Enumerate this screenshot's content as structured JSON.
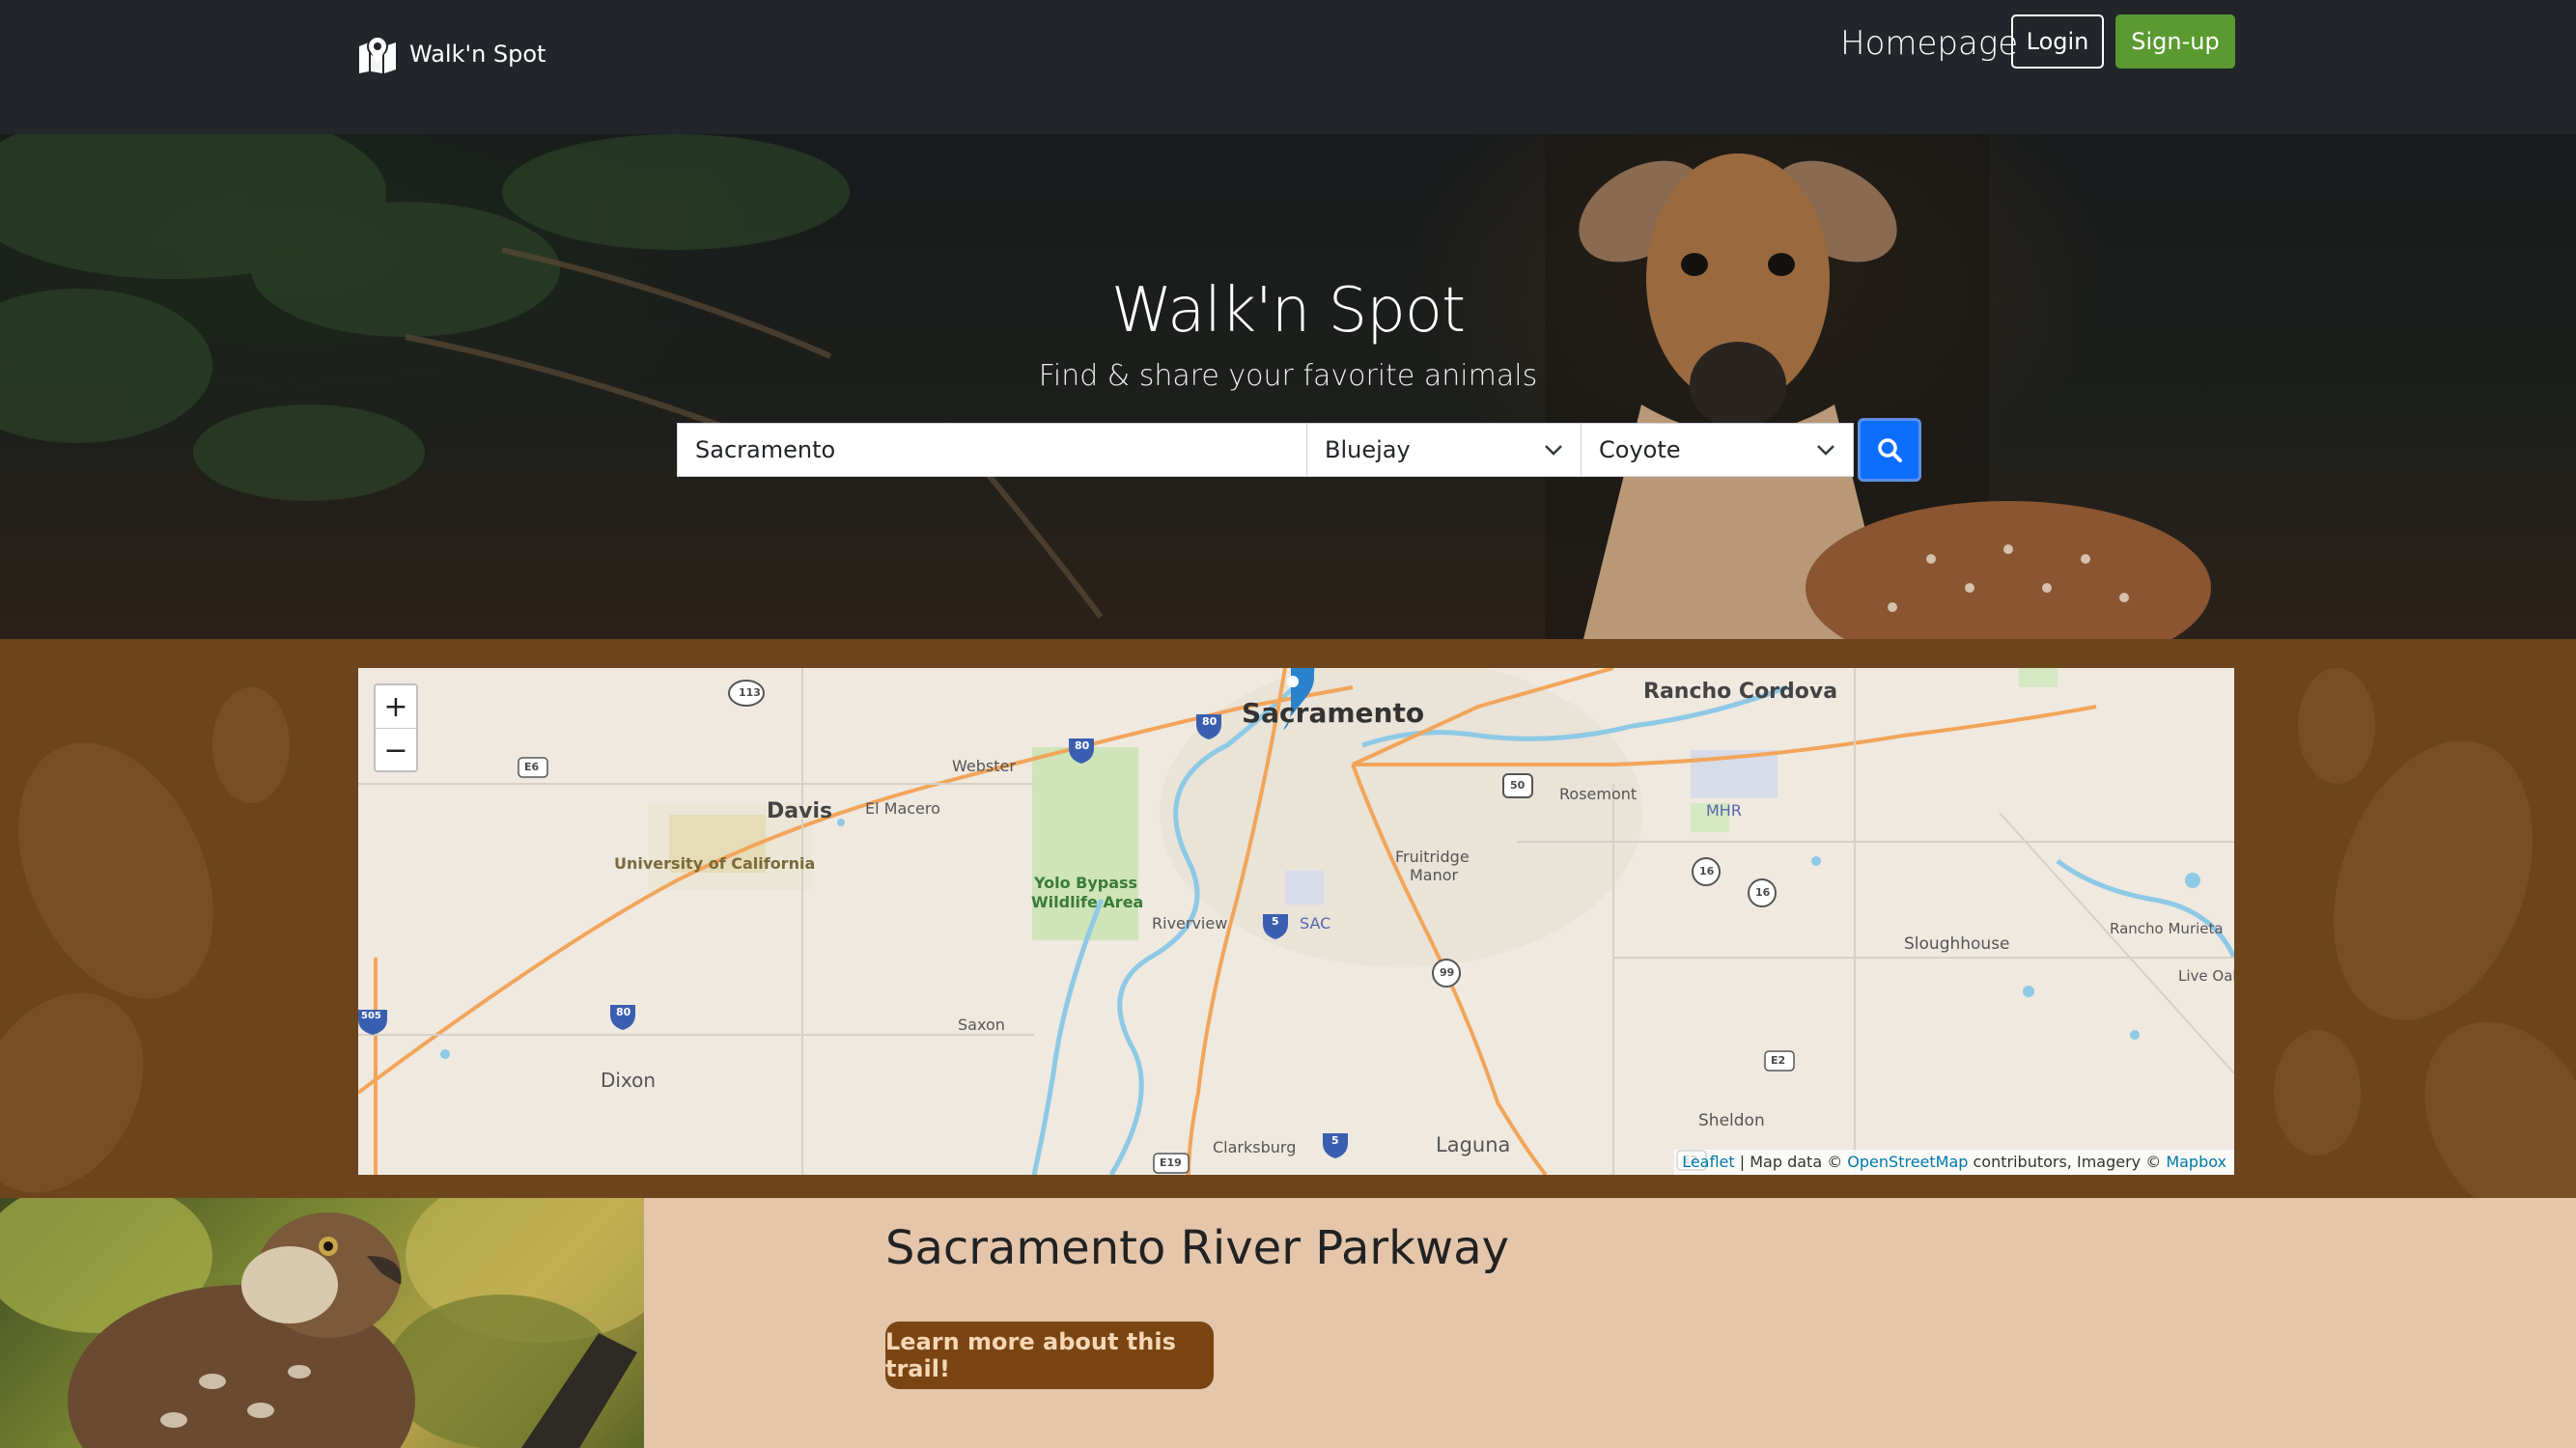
{
  "nav": {
    "brand": "Walk'n Spot",
    "homepage": "Homepage",
    "login": "Login",
    "signup": "Sign-up",
    "signup_color": "#5a9a30"
  },
  "hero": {
    "title": "Walk'n Spot",
    "subtitle": "Find & share your favorite animals",
    "search": {
      "location_value": "Sacramento",
      "animal_1_selected": "Bluejay",
      "animal_2_selected": "Coyote",
      "search_icon": "search-icon",
      "button_color": "#0d6efd"
    }
  },
  "map": {
    "zoom_in": "+",
    "zoom_out": "−",
    "labels": {
      "sacramento": "Sacramento",
      "rancho_cordova": "Rancho Cordova",
      "davis": "Davis",
      "el_macero": "El Macero",
      "webster": "Webster",
      "university": "University of California",
      "yolo": "Yolo Bypass",
      "wildlife": "Wildlife Area",
      "fruitridge": "Fruitridge",
      "manor": "Manor",
      "rosemont": "Rosemont",
      "mhr": "MHR",
      "riverview": "Riverview",
      "sac": "SAC",
      "sloughhouse": "Sloughhouse",
      "rancho_murieta": "Rancho Murieta",
      "live_oak": "Live Oak",
      "saxon": "Saxon",
      "dixon": "Dixon",
      "sheldon": "Sheldon",
      "clarksburg": "Clarksburg",
      "laguna": "Laguna"
    },
    "shields": {
      "s113": "113",
      "e6": "E6",
      "i80a": "80",
      "i80b": "80",
      "i80c": "80",
      "i5a": "5",
      "i5b": "5",
      "us50": "50",
      "r16a": "16",
      "r16b": "16",
      "r99": "99",
      "e2a": "E2",
      "e2b": "E2",
      "e19": "E19",
      "i505": "505"
    },
    "attribution": {
      "leaflet": "Leaflet",
      "map_data": " | Map data © ",
      "osm": "OpenStreetMap",
      "contrib": " contributors, Imagery © ",
      "mapbox": "Mapbox"
    }
  },
  "trail": {
    "title": "Sacramento River Parkway",
    "button": "Learn more about this trail!",
    "button_color": "#7a4513"
  }
}
